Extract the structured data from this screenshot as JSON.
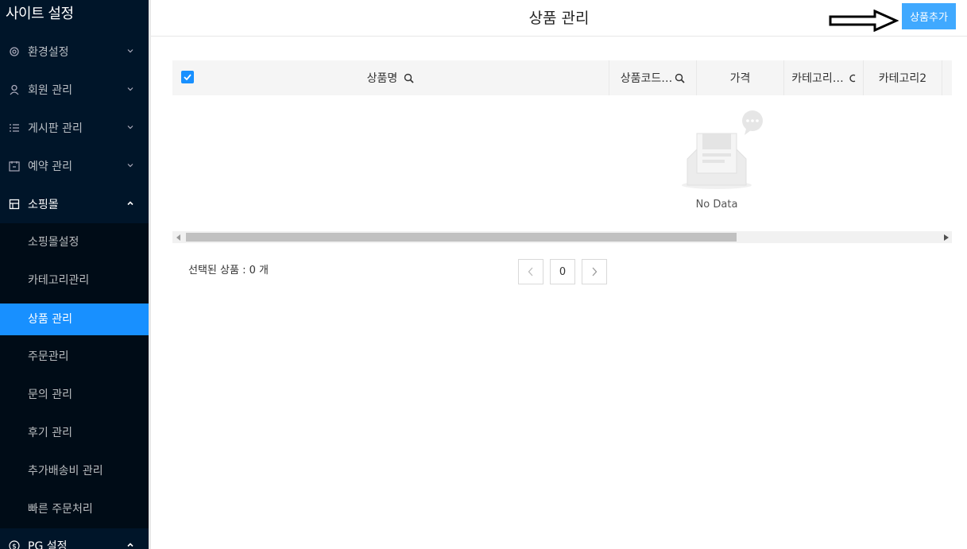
{
  "sidebar": {
    "title": "사이트 설정",
    "menus": [
      {
        "label": "환경설정",
        "icon": "gear-icon"
      },
      {
        "label": "회원 관리",
        "icon": "user-icon"
      },
      {
        "label": "게시판 관리",
        "icon": "list-icon"
      },
      {
        "label": "예약 관리",
        "icon": "calendar-icon"
      },
      {
        "label": "소핑몰",
        "icon": "shop-icon"
      }
    ],
    "submenu": [
      "소핑몰설정",
      "카테고리관리",
      "상품 관리",
      "주문관리",
      "문의 관리",
      "후기 관리",
      "추가배송비 관리",
      "빠른 주문처리"
    ],
    "active_submenu": "상품 관리",
    "pg_label": "PG 설정"
  },
  "header": {
    "title": "상품 관리",
    "add_button": "상품추가"
  },
  "table": {
    "columns": [
      "상품명",
      "상품코드…",
      "가격",
      "카테고리…",
      "카테고리2"
    ],
    "empty_text": "No Data"
  },
  "footer": {
    "selected_label": "선택된 상품 : 0 개",
    "page": "0"
  },
  "colors": {
    "sidebar_bg": "#001529",
    "accent": "#1890ff",
    "button": "#40a9ff"
  }
}
